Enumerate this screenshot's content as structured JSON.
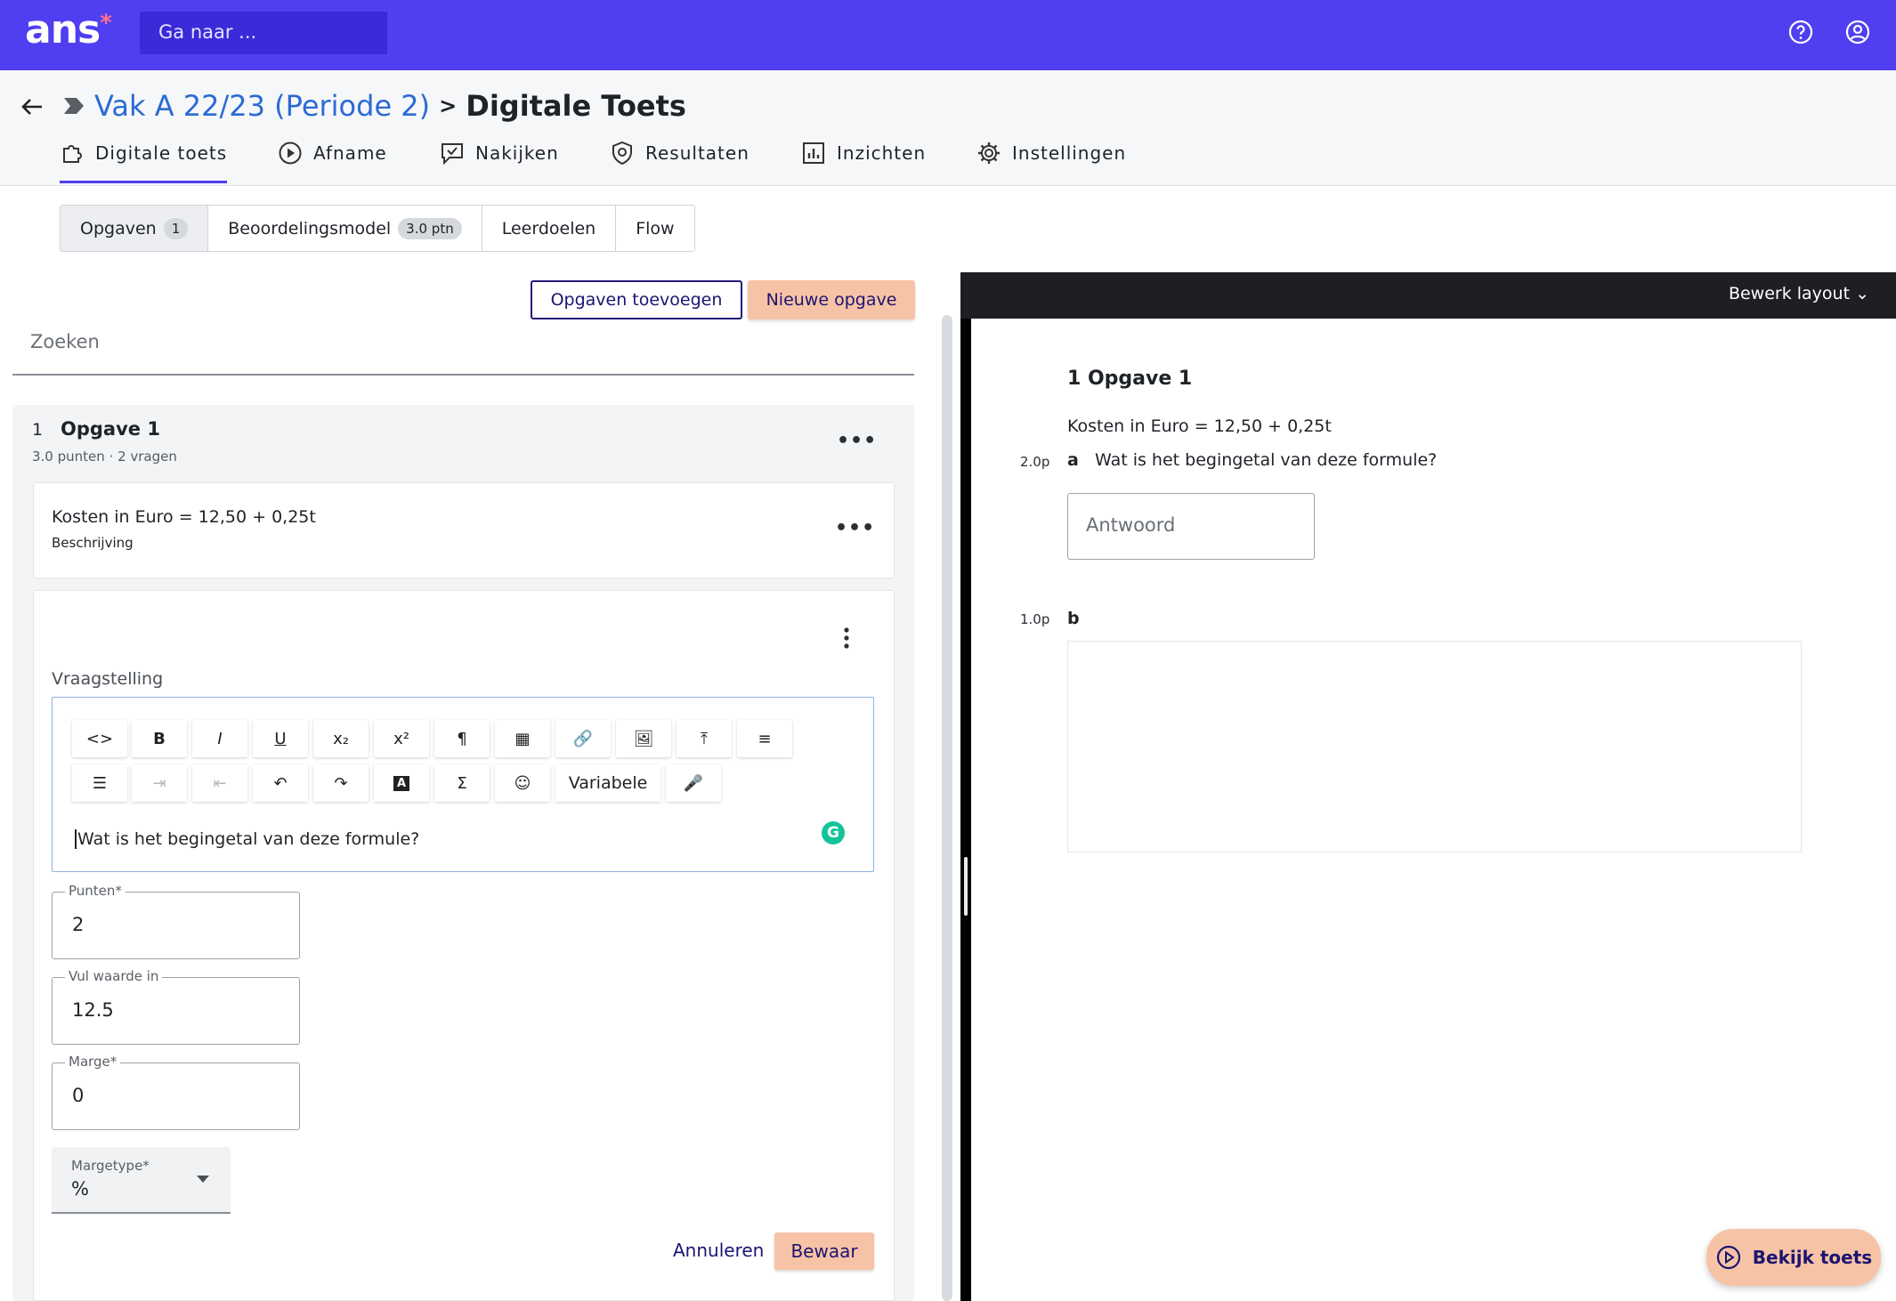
{
  "app": {
    "logo": "ans",
    "logo_mark": "*",
    "search_placeholder": "Ga naar ..."
  },
  "breadcrumb": {
    "parent": "Vak A 22/23 (Periode 2)",
    "separator": ">",
    "current": "Digitale Toets"
  },
  "nav_tabs": [
    {
      "label": "Digitale toets",
      "icon": "puzzle-icon",
      "active": true
    },
    {
      "label": "Afname",
      "icon": "play-circle-icon"
    },
    {
      "label": "Nakijken",
      "icon": "comment-check-icon"
    },
    {
      "label": "Resultaten",
      "icon": "shield-icon"
    },
    {
      "label": "Inzichten",
      "icon": "bar-chart-icon"
    },
    {
      "label": "Instellingen",
      "icon": "gear-icon"
    }
  ],
  "segments": [
    {
      "label": "Opgaven",
      "badge": "1",
      "active": true
    },
    {
      "label": "Beoordelingsmodel",
      "badge": "3.0 ptn"
    },
    {
      "label": "Leerdoelen"
    },
    {
      "label": "Flow"
    }
  ],
  "actions": {
    "add_label": "Opgaven toevoegen",
    "new_label": "Nieuwe opgave"
  },
  "search": {
    "placeholder": "Zoeken"
  },
  "opgave": {
    "number": "1",
    "title": "Opgave 1",
    "meta": "3.0 punten · 2 vragen",
    "menu": "•••",
    "description": {
      "text": "Kosten in Euro = 12,50 + 0,25t",
      "sub": "Beschrijving",
      "menu": "•••"
    }
  },
  "editor": {
    "label": "Vraagstelling",
    "toolbar_row1": [
      "<>",
      "B",
      "I",
      "U",
      "x₂",
      "x²",
      "¶",
      "▦",
      "🔗",
      "🖼",
      "⤒",
      "≡"
    ],
    "toolbar_row2": [
      "☰",
      "⇥",
      "⇤",
      "↶",
      "↷",
      "A",
      "Σ",
      "☺",
      "Variabele",
      "🎤"
    ],
    "text": "Wat is het begingetal van deze formule?",
    "grammarly": "G"
  },
  "fields": {
    "punten": {
      "label": "Punten*",
      "value": "2"
    },
    "vul_waarde": {
      "label": "Vul waarde in",
      "value": "12.5"
    },
    "marge": {
      "label": "Marge*",
      "value": "0"
    },
    "margetype": {
      "label": "Margetype*",
      "value": "%"
    }
  },
  "form_actions": {
    "cancel": "Annuleren",
    "save": "Bewaar"
  },
  "preview": {
    "layout_button": "Bewerk layout ⌄",
    "title": "1 Opgave 1",
    "description": "Kosten in Euro = 12,50 + 0,25t",
    "questions": [
      {
        "points": "2.0p",
        "letter": "a",
        "text": "Wat is het begingetal van deze formule?",
        "answer_placeholder": "Antwoord"
      },
      {
        "points": "1.0p",
        "letter": "b"
      }
    ]
  },
  "fab": {
    "label": "Bekijk toets"
  }
}
